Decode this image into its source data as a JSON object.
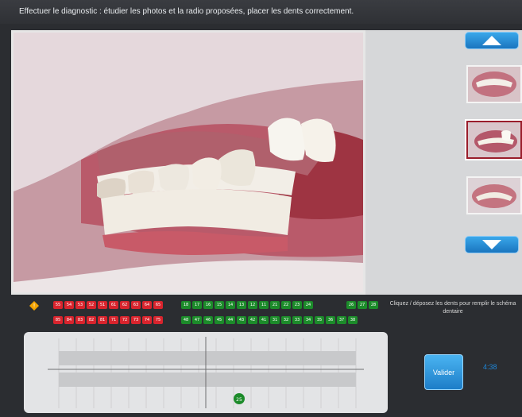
{
  "header": {
    "instruction": "Effectuer le diagnostic : étudier les photos et la radio proposées, placer les dents correctement."
  },
  "teeth": {
    "red_top": [
      "55",
      "54",
      "53",
      "52",
      "51",
      "61",
      "62",
      "63",
      "64",
      "65"
    ],
    "red_bottom": [
      "85",
      "84",
      "83",
      "82",
      "81",
      "71",
      "72",
      "73",
      "74",
      "75"
    ],
    "green_top_a": [
      "18",
      "17",
      "16",
      "15",
      "14",
      "13",
      "12",
      "11",
      "21",
      "22",
      "23",
      "24"
    ],
    "green_top_b": [
      "26",
      "27",
      "28"
    ],
    "green_bottom": [
      "48",
      "47",
      "46",
      "45",
      "44",
      "43",
      "42",
      "41",
      "31",
      "32",
      "33",
      "34",
      "35",
      "36",
      "37",
      "38"
    ]
  },
  "side_instruction": "Cliquez / déposez les dents pour remplir le schéma dentaire",
  "chart": {
    "marker_label": "25"
  },
  "controls": {
    "validate": "Valider",
    "timer": "4:38"
  },
  "colors": {
    "accent": "#1a75bf",
    "deciduous": "#d8242d",
    "permanent": "#1c8b2a"
  }
}
